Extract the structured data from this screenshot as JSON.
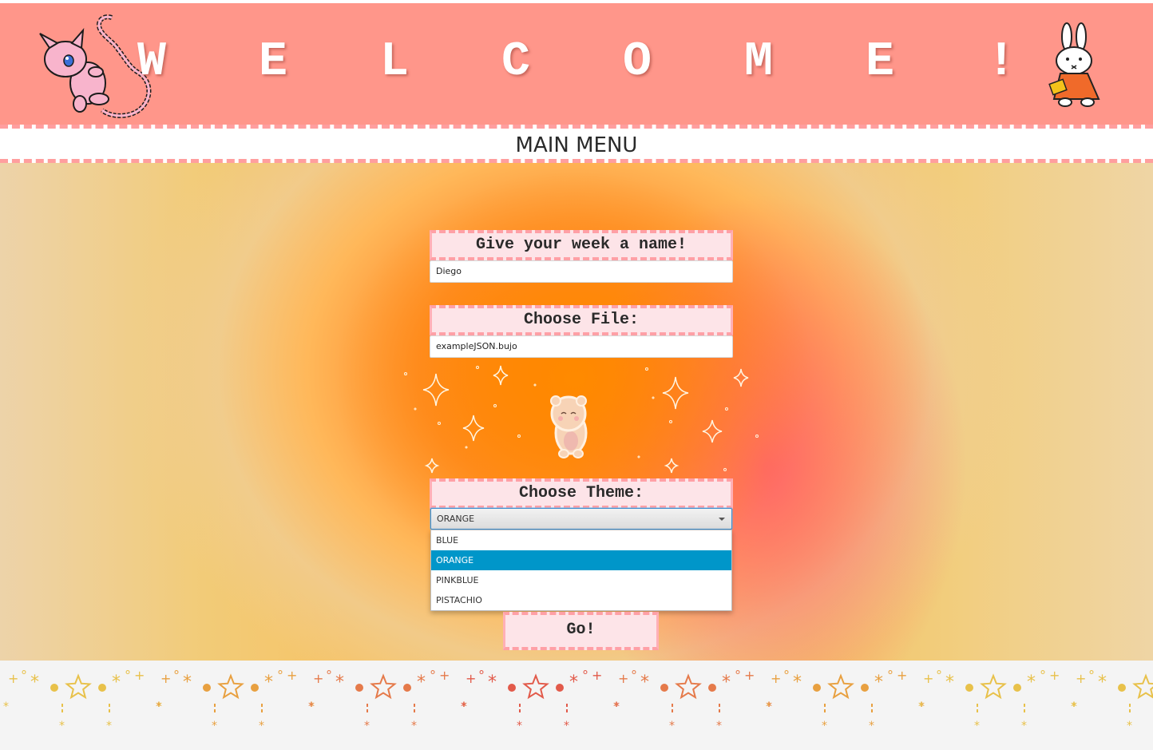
{
  "header": {
    "title": "W E L C O M E !",
    "left_icon": "mew-pixel-icon",
    "right_icon": "miffy-bunny-icon",
    "background": "#ff968a"
  },
  "menu": {
    "title": "MAIN MENU"
  },
  "form": {
    "week_name_label": "Give your week a name!",
    "week_name_value": "Diego",
    "file_label": "Choose File:",
    "file_value": "exampleJSON.bujo",
    "theme_label": "Choose Theme:",
    "theme_selected": "ORANGE",
    "theme_options": [
      "BLUE",
      "ORANGE",
      "PINKBLUE",
      "PISTACHIO"
    ],
    "go_label": "Go!"
  },
  "decor": {
    "center_icon": "teddy-bear-icon",
    "sparkle_icon": "sparkle-icon",
    "footer_icon": "star-border-icon"
  },
  "colors": {
    "accent_pink": "#ffa0a6",
    "label_bg": "#fde4e8",
    "orange": "#ff8a00",
    "selected_option": "#0096c9"
  }
}
